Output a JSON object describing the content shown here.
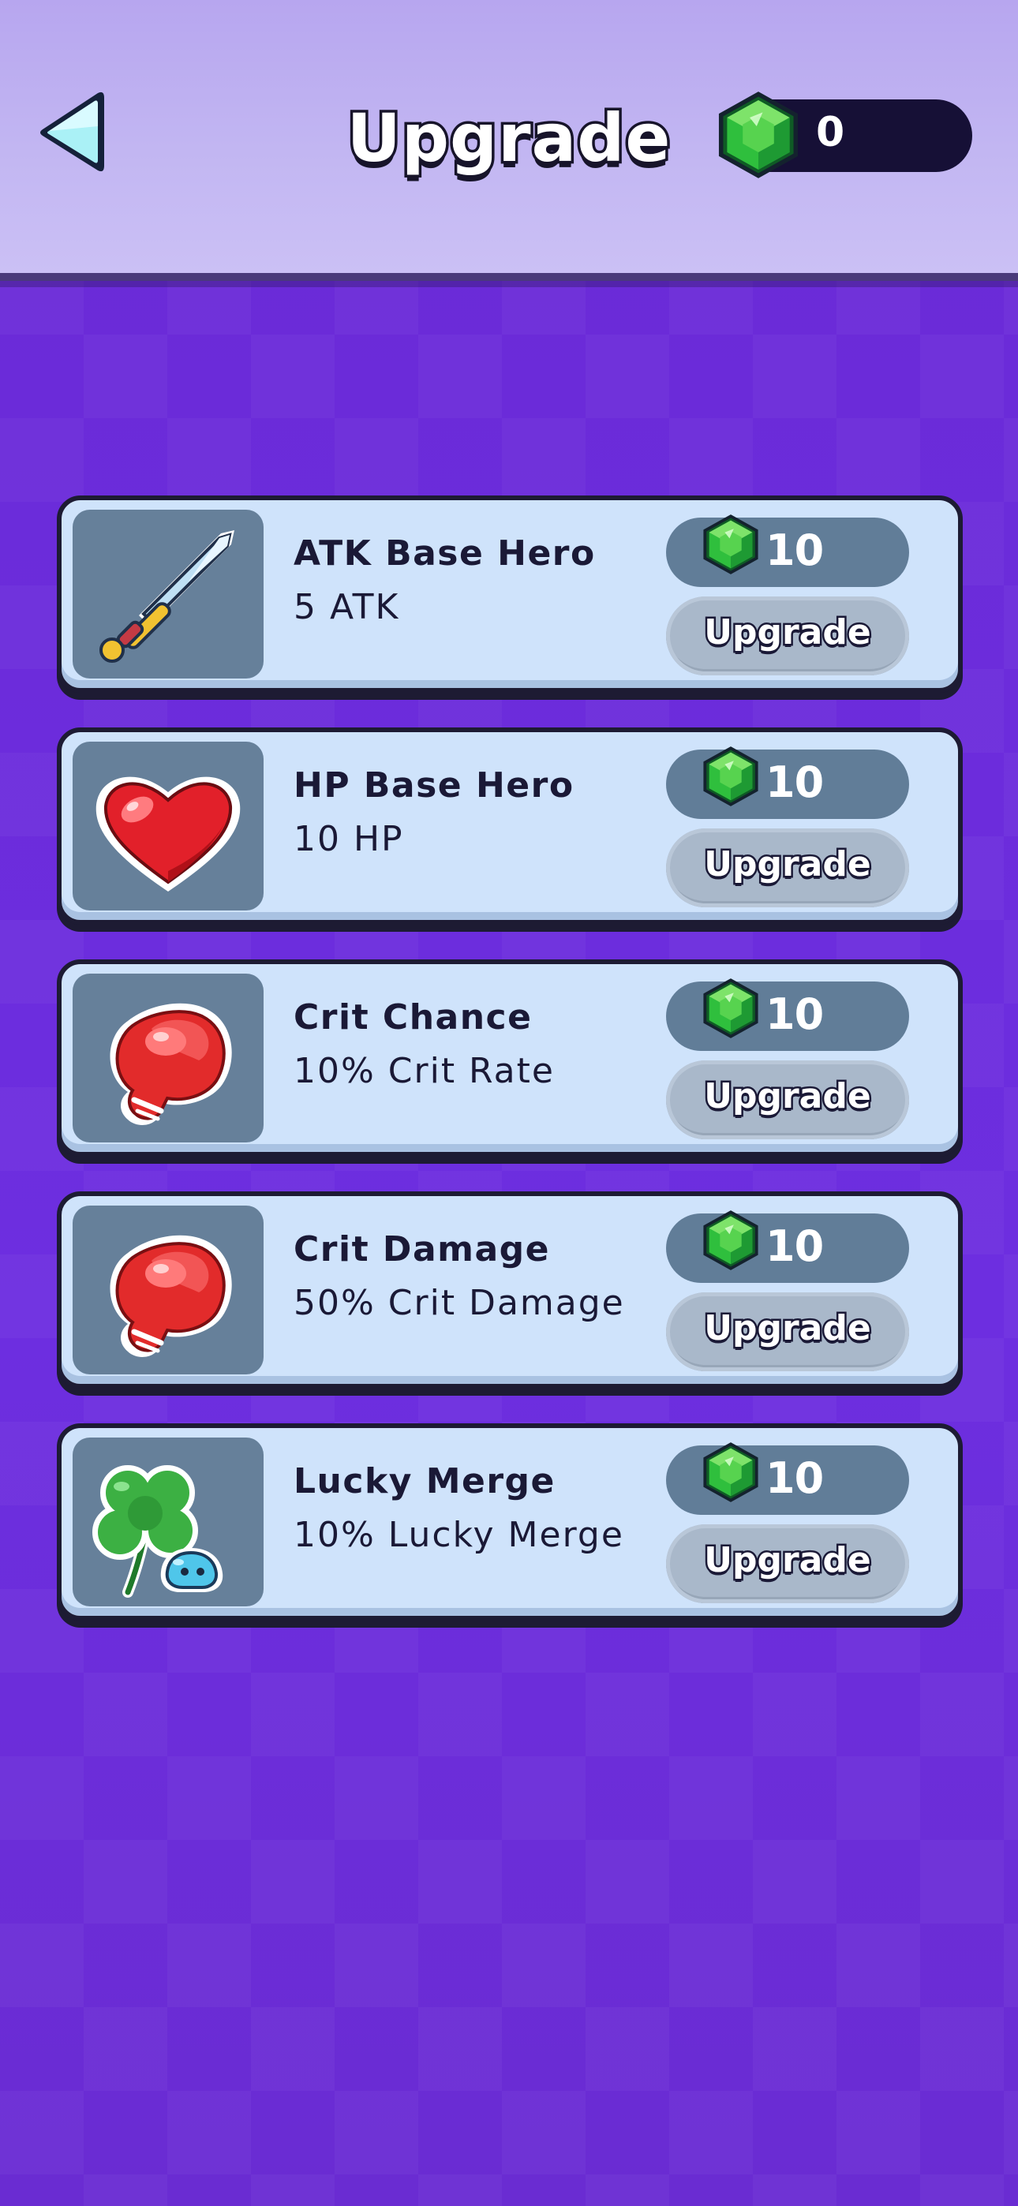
{
  "header": {
    "title": "Upgrade",
    "gems": "0",
    "back_icon": "back-arrow-icon",
    "gem_icon": "green-gem-icon"
  },
  "colors": {
    "background": "#6a2fd8",
    "header": "#c2b6f2",
    "card": "#cfe3fb",
    "icon_box": "#66809a",
    "cost_pill": "#617d98",
    "upgrade_button": "#a9b8ca",
    "text_dark": "#1a1936"
  },
  "upgrades": [
    {
      "title": "ATK Base Hero",
      "desc": "5 ATK",
      "cost": "10",
      "button": "Upgrade",
      "icon": "sword-icon"
    },
    {
      "title": "HP Base Hero",
      "desc": "10 HP",
      "cost": "10",
      "button": "Upgrade",
      "icon": "heart-icon"
    },
    {
      "title": "Crit Chance",
      "desc": "10% Crit Rate",
      "cost": "10",
      "button": "Upgrade",
      "icon": "boxing-glove-icon"
    },
    {
      "title": "Crit Damage",
      "desc": "50% Crit Damage",
      "cost": "10",
      "button": "Upgrade",
      "icon": "boxing-glove-icon"
    },
    {
      "title": "Lucky Merge",
      "desc": "10% Lucky Merge",
      "cost": "10",
      "button": "Upgrade",
      "icon": "clover-slime-icon"
    }
  ]
}
